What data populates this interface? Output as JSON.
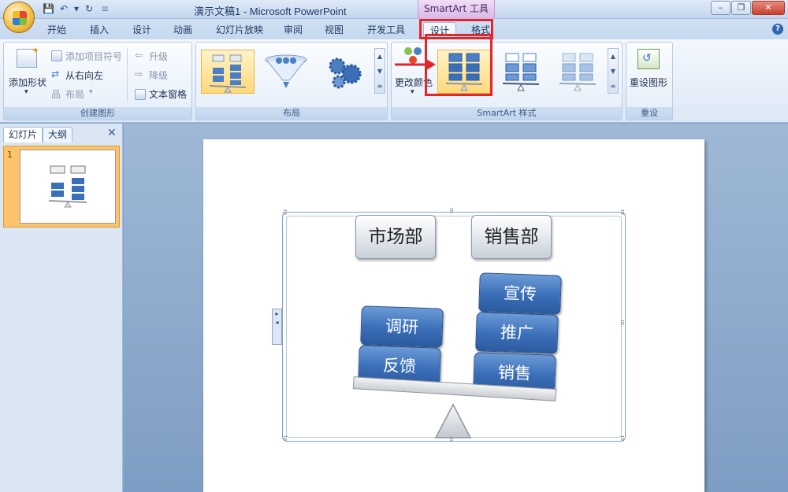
{
  "titlebar": {
    "title": "演示文稿1 - Microsoft PowerPoint",
    "tools_tab": "SmartArt 工具"
  },
  "tabs": [
    "开始",
    "插入",
    "设计",
    "动画",
    "幻灯片放映",
    "审阅",
    "视图",
    "开发工具",
    "设计",
    "格式"
  ],
  "ribbon": {
    "create_graphic": {
      "label": "创建图形",
      "add_shape": "添加形状",
      "add_bullet": "添加项目符号",
      "right_to_left": "从右向左",
      "layout": "布局",
      "promote": "升级",
      "demote": "降级",
      "text_pane": "文本窗格"
    },
    "layouts": {
      "label": "布局"
    },
    "styles": {
      "label": "SmartArt 样式",
      "change_colors": "更改颜色"
    },
    "reset": {
      "label": "重设",
      "reset_graphic": "重设图形"
    }
  },
  "left_pane": {
    "tab_slides": "幻灯片",
    "tab_outline": "大纲",
    "slide_number": "1"
  },
  "slide": {
    "headers": [
      "市场部",
      "销售部"
    ],
    "left_items": [
      "调研",
      "反馈"
    ],
    "right_items": [
      "宣传",
      "推广",
      "销售"
    ]
  },
  "colors": {
    "highlight": "#e3262b",
    "shape_blue": "#3a6eb8",
    "ribbon_bg": "#dde8f6"
  }
}
